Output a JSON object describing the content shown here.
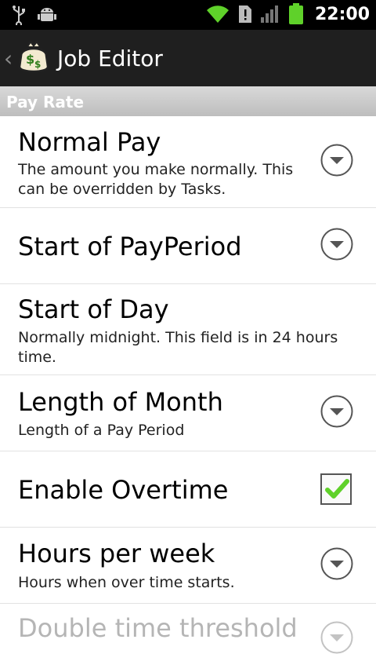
{
  "status_bar": {
    "time": "22:00",
    "icons": [
      "usb-icon",
      "android-debug-icon",
      "wifi-icon",
      "sim-alert-icon",
      "signal-icon",
      "battery-icon"
    ]
  },
  "app_bar": {
    "title": "Job Editor",
    "back_icon": "chevron-left-icon",
    "app_icon": "money-bag-icon"
  },
  "section": {
    "label": "Pay Rate"
  },
  "prefs": [
    {
      "title": "Normal Pay",
      "summary": "The amount you make normally. This can be overridden by Tasks.",
      "widget": "dropdown"
    },
    {
      "title": "Start of PayPeriod",
      "summary": "",
      "widget": "dropdown"
    },
    {
      "title": "Start of Day",
      "summary": "Normally midnight. This field is in 24 hours time.",
      "widget": "none"
    },
    {
      "title": "Length of Month",
      "summary": "Length of a Pay Period",
      "widget": "dropdown"
    },
    {
      "title": "Enable Overtime",
      "summary": "",
      "widget": "checkbox",
      "checked": true
    },
    {
      "title": "Hours per week",
      "summary": "Hours when over time starts.",
      "widget": "dropdown"
    },
    {
      "title": "Double time threshold",
      "summary": "",
      "widget": "dropdown"
    }
  ],
  "colors": {
    "accent_check": "#5fd12a",
    "title_bar": "#1f1f1f",
    "section_header": "#c9c9c9"
  }
}
